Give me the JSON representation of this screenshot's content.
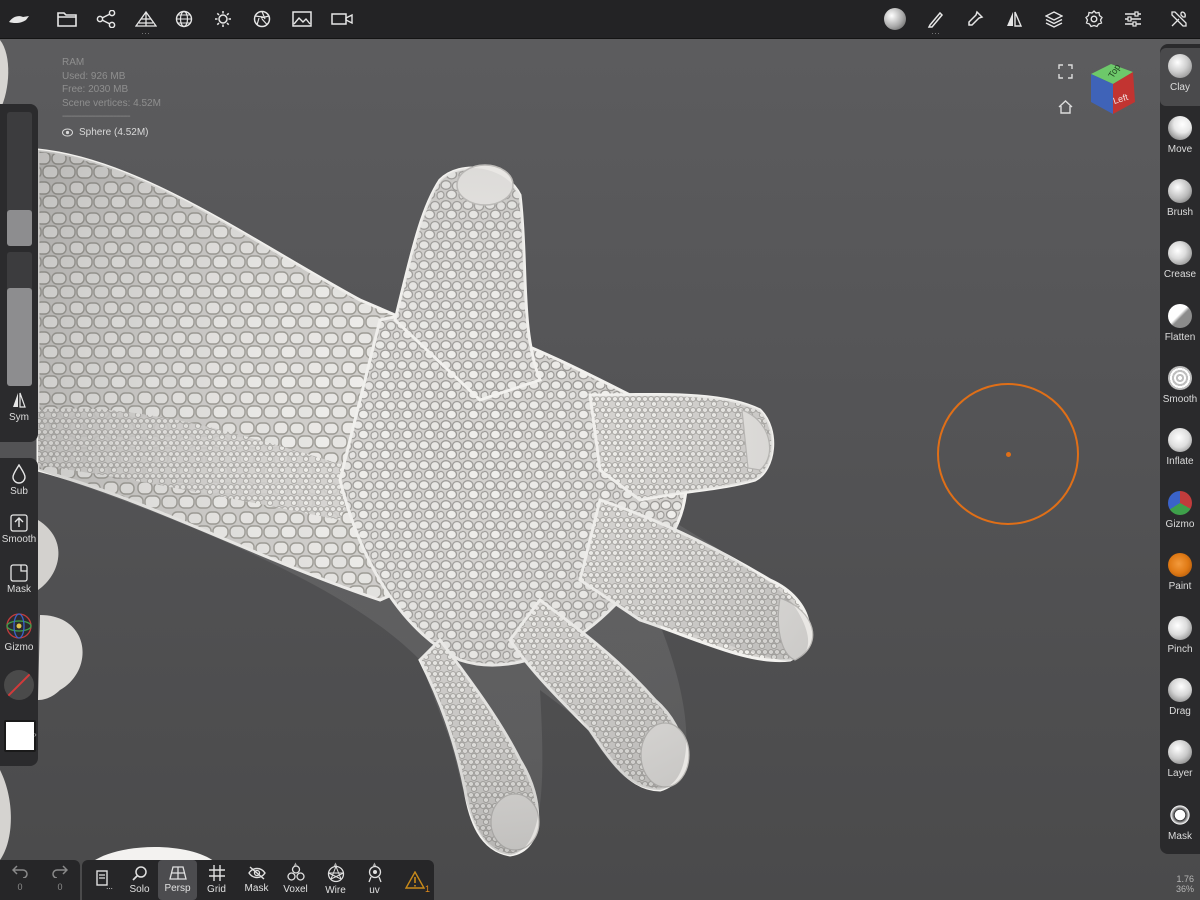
{
  "stats": {
    "ram_label": "RAM",
    "used": "Used: 926 MB",
    "free": "Free: 2030 MB",
    "vertices": "Scene vertices: 4.52M",
    "separator": "-----------------------------",
    "mesh_name": "Sphere (4.52M)"
  },
  "topbar": {
    "left_icons": [
      "logo-icon",
      "folder-icon",
      "scene-graph-icon",
      "topology-icon",
      "globe-icon",
      "sun-icon",
      "aperture-icon",
      "image-icon",
      "camera-icon"
    ],
    "right_icons": [
      "matcap-icon",
      "paint-brush-icon",
      "picker-icon",
      "symmetry-icon",
      "layers-icon",
      "settings-icon",
      "sliders-icon",
      "tools-icon"
    ]
  },
  "left_panel": {
    "sym_label": "Sym"
  },
  "left_tools": {
    "sub_label": "Sub",
    "smooth_label": "Smooth",
    "mask_label": "Mask",
    "gizmo_label": "Gizmo"
  },
  "brushes": [
    {
      "label": "Clay",
      "active": true
    },
    {
      "label": "Move",
      "active": false
    },
    {
      "label": "Brush",
      "active": false
    },
    {
      "label": "Crease",
      "active": false
    },
    {
      "label": "Flatten",
      "active": false
    },
    {
      "label": "Smooth",
      "active": false
    },
    {
      "label": "Inflate",
      "active": false
    },
    {
      "label": "Gizmo",
      "active": false
    },
    {
      "label": "Paint",
      "active": false
    },
    {
      "label": "Pinch",
      "active": false
    },
    {
      "label": "Drag",
      "active": false
    },
    {
      "label": "Layer",
      "active": false
    },
    {
      "label": "Mask",
      "active": false
    }
  ],
  "view_cube": {
    "top": "Top",
    "left": "Left"
  },
  "bottom": {
    "undo_count": "0",
    "redo_count": "0",
    "more_label": "...",
    "solo_label": "Solo",
    "persp_label": "Persp",
    "grid_label": "Grid",
    "mask_label": "Mask",
    "voxel_label": "Voxel",
    "wire_label": "Wire",
    "uv_label": "uv",
    "warning_count": "1"
  },
  "zoom": {
    "line1": "1.76",
    "line2": "36%"
  },
  "colors": {
    "accent": "#e06f17",
    "panel": "#2a2a2c",
    "viewport": "#555557"
  }
}
